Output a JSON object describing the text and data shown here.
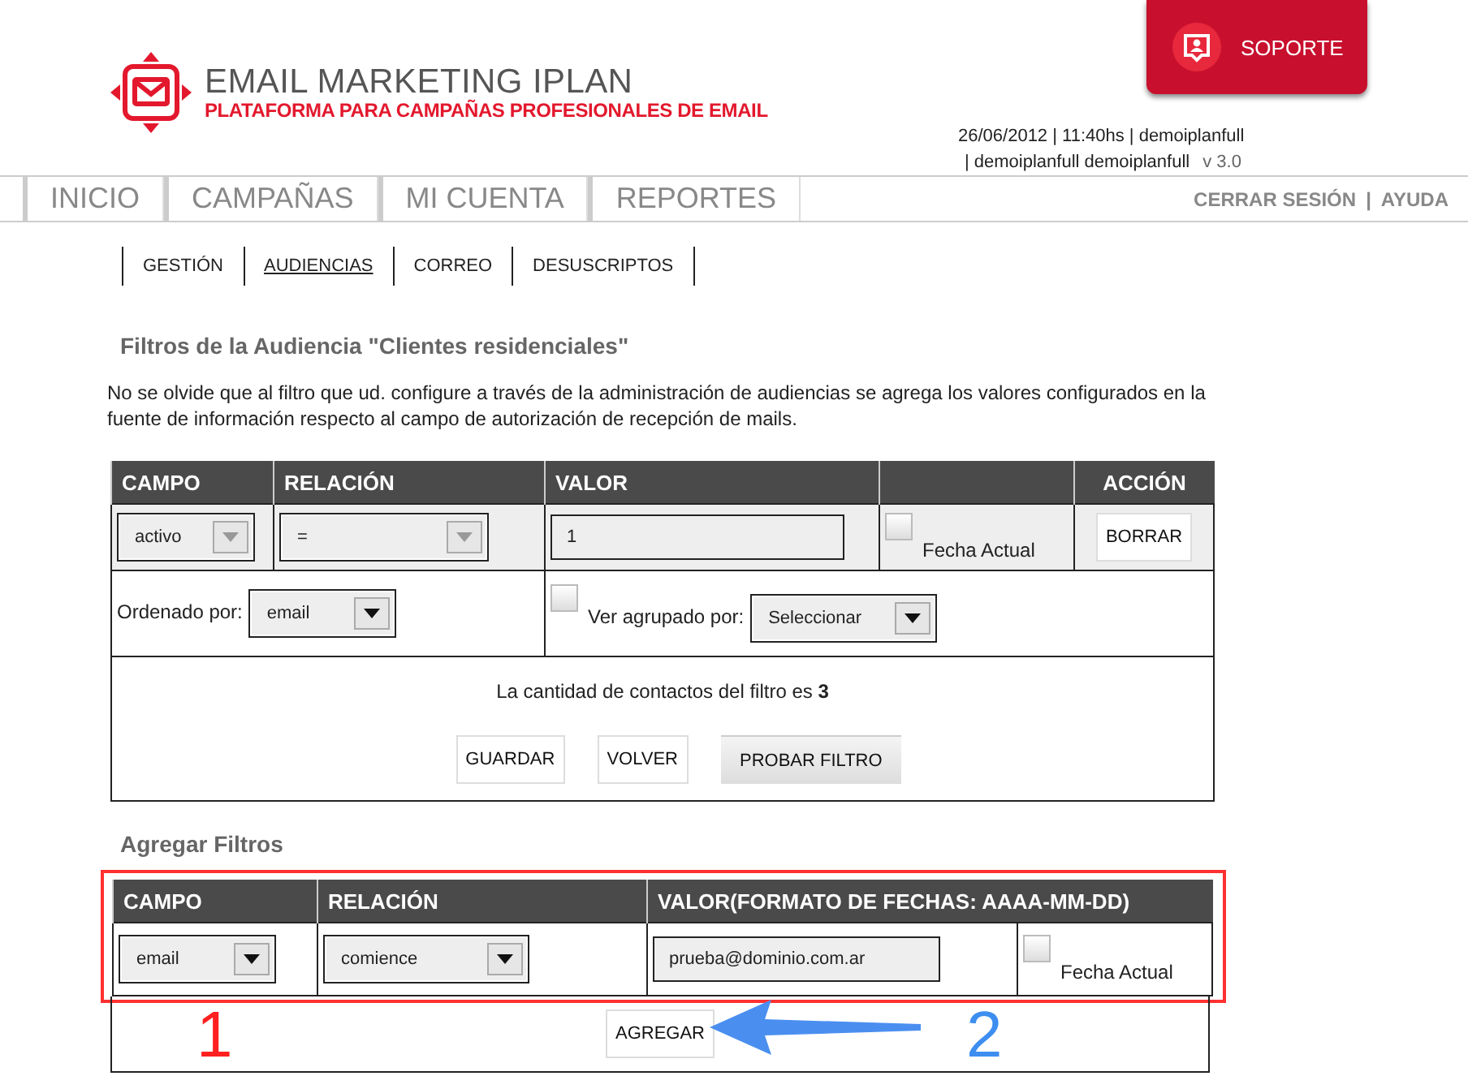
{
  "header": {
    "logo_title": "EMAIL MARKETING IPLAN",
    "logo_subtitle": "PLATAFORMA PARA CAMPAÑAS PROFESIONALES DE EMAIL",
    "support_button": "SOPORTE",
    "session_line_1": "26/06/2012  |  11:40hs  | demoiplanfull",
    "session_line_2": "| demoiplanfull demoiplanfull",
    "version": "v 3.0"
  },
  "nav": {
    "items": [
      "INICIO",
      "CAMPAÑAS",
      "MI CUENTA",
      "REPORTES"
    ],
    "links": [
      "CERRAR SESIÓN",
      "AYUDA"
    ],
    "link_separator": "|"
  },
  "subnav": [
    {
      "label": "GESTIÓN",
      "selected": false
    },
    {
      "label": "AUDIENCIAS",
      "selected": true
    },
    {
      "label": "CORREO",
      "selected": false
    },
    {
      "label": "DESUSCRIPTOS",
      "selected": false
    }
  ],
  "filters": {
    "title": "Filtros de la Audiencia \"Clientes residenciales\"",
    "notice": "No se olvide que al filtro que ud. configure a través de la administración de audiencias se agrega los valores configurados en la fuente de información respecto al campo de autorización de recepción de mails.",
    "columns": [
      {
        "label": "CAMPO"
      },
      {
        "label": "RELACIÓN"
      },
      {
        "label": "VALOR"
      },
      {},
      {
        "label": "ACCIÓN"
      }
    ],
    "row": {
      "campo": "activo",
      "relacion": "=",
      "valor": "1",
      "fecha_actual": {
        "label": "Fecha Actual",
        "checked": false
      },
      "action": "BORRAR"
    },
    "sort": {
      "label": "Ordenado por:",
      "value": "email"
    },
    "group": {
      "checked": false,
      "label": "Ver agrupado por:",
      "value": "Seleccionar"
    },
    "count": "La cantidad de contactos del filtro es **3**",
    "buttons": [
      {
        "label": "GUARDAR",
        "kind": "plain"
      },
      {
        "label": "VOLVER",
        "kind": "plain"
      },
      {
        "label": "PROBAR FILTRO",
        "kind": "raised"
      }
    ]
  },
  "add": {
    "title": "Agregar Filtros",
    "columns": [
      "CAMPO",
      "RELACIÓN",
      "VALOR(FORMATO DE FECHAS: AAAA-MM-DD)"
    ],
    "row": {
      "campo": "email",
      "relacion": "comience",
      "valor": "prueba@dominio.com.ar",
      "fecha_actual": {
        "label": "Fecha Actual",
        "checked": false
      }
    },
    "button": "AGREGAR",
    "markers": [
      {
        "text": "1",
        "color": "#ff2020"
      },
      {
        "text": "2",
        "color": "#3d8ef0"
      }
    ]
  }
}
